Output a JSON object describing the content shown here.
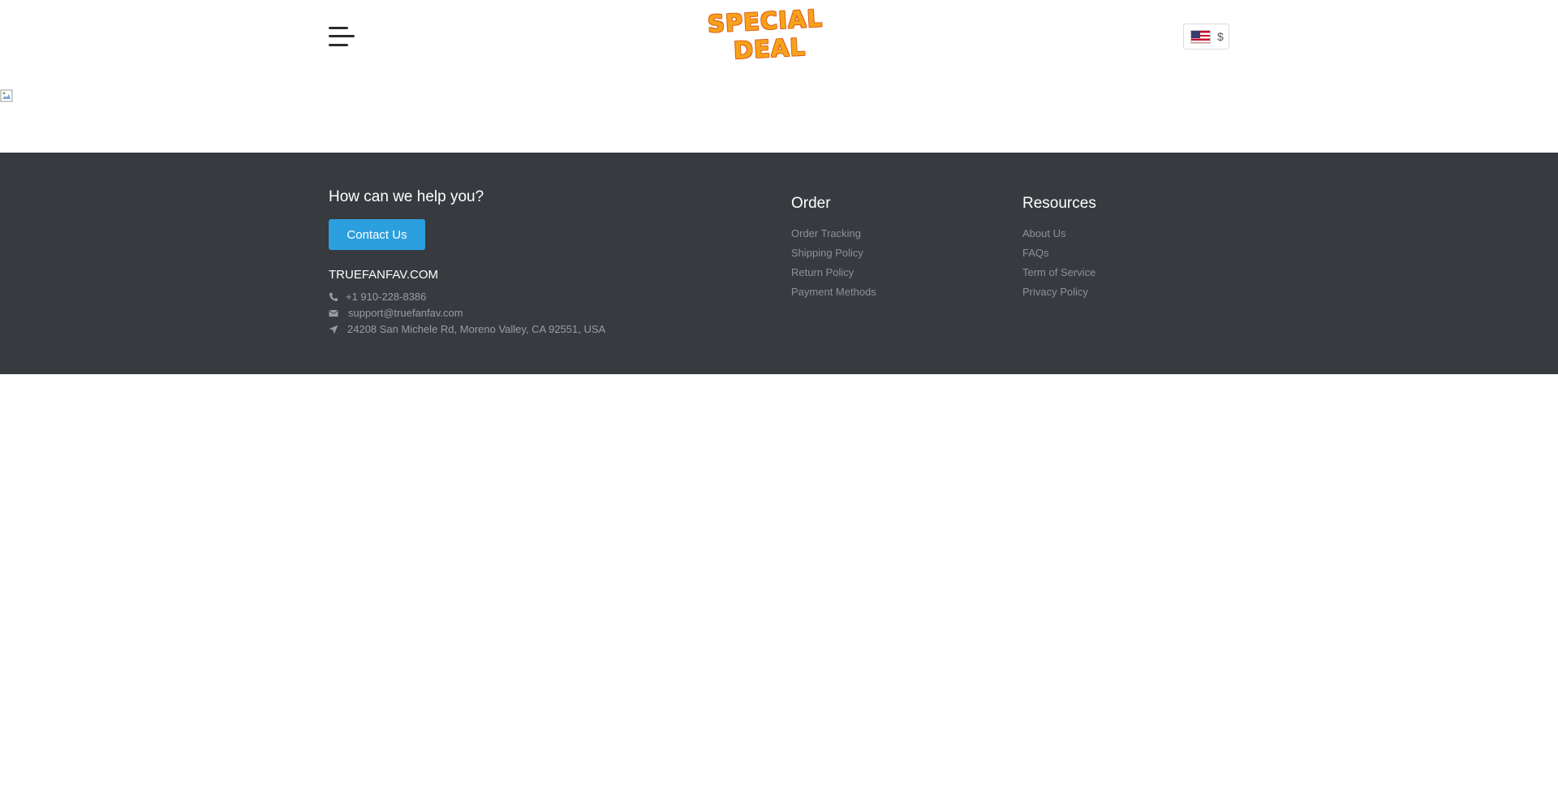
{
  "header": {
    "logo_text_line1": "SPECIAL",
    "logo_text_line2": "DEAL",
    "menu_icon": "hamburger-menu-icon",
    "currency": {
      "flag_icon": "us-flag-icon",
      "symbol": "$"
    }
  },
  "footer": {
    "help_title": "How can we help you?",
    "contact_button": "Contact Us",
    "site_name": "TRUEFANFAV.COM",
    "phone": "+1 910-228-8386",
    "email": "support@truefanfav.com",
    "address": "24208 San Michele Rd, Moreno Valley, CA 92551, USA",
    "order": {
      "title": "Order",
      "links": [
        "Order Tracking",
        "Shipping Policy",
        "Return Policy",
        "Payment Methods"
      ]
    },
    "resources": {
      "title": "Resources",
      "links": [
        "About Us",
        "FAQs",
        "Term of Service",
        "Privacy Policy"
      ]
    }
  },
  "colors": {
    "footer_bg": "#373a3f",
    "accent_button": "#2c9fde",
    "logo_orange": "#f7a21b"
  }
}
